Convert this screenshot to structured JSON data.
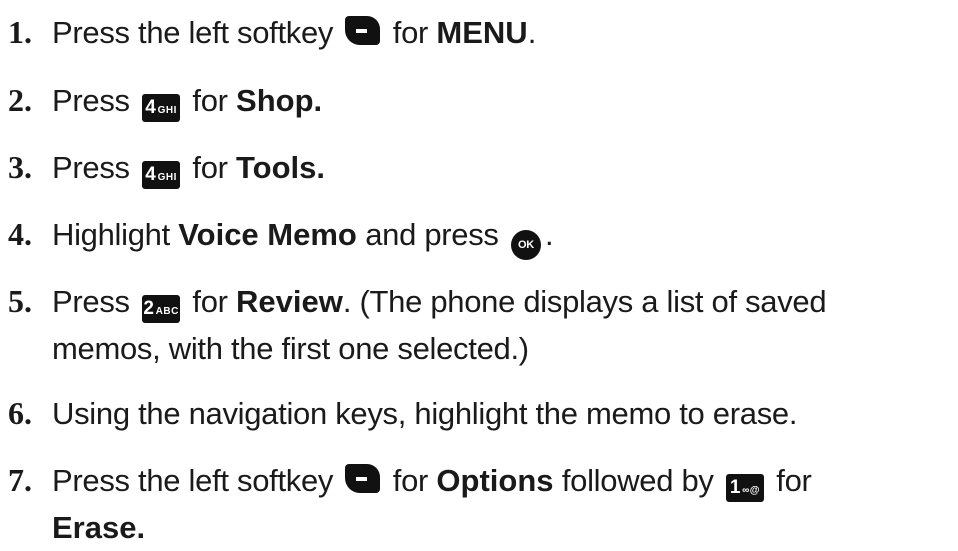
{
  "steps": [
    {
      "number": "1.",
      "t1": "Press the left softkey",
      "key": "left-softkey",
      "t2": "for",
      "bold": "MENU",
      "t3": "."
    },
    {
      "number": "2.",
      "t1": "Press",
      "key": {
        "digit": "4",
        "letters": "GHI"
      },
      "t2": "for",
      "bold": "Shop."
    },
    {
      "number": "3.",
      "t1": "Press",
      "key": {
        "digit": "4",
        "letters": "GHI"
      },
      "t2": "for",
      "bold": "Tools."
    },
    {
      "number": "4.",
      "t1": "Highlight",
      "bold": "Voice Memo",
      "t2": "and press",
      "key": {
        "label": "OK"
      },
      "t3": "."
    },
    {
      "number": "5.",
      "t1": "Press",
      "key": {
        "digit": "2",
        "letters": "ABC"
      },
      "t2": "for",
      "bold": "Review",
      "t3": ". (The phone displays a list of saved",
      "line2": "memos, with the first one selected.)"
    },
    {
      "number": "6.",
      "text": "Using the navigation keys, highlight the memo to erase."
    },
    {
      "number": "7.",
      "t1": "Press the left softkey",
      "key": "left-softkey",
      "t2": "for",
      "bold": "Options",
      "t3": "followed by",
      "key2": {
        "digit": "1",
        "letters": "∞@"
      },
      "t4": "for",
      "line2_bold": "Erase."
    }
  ]
}
